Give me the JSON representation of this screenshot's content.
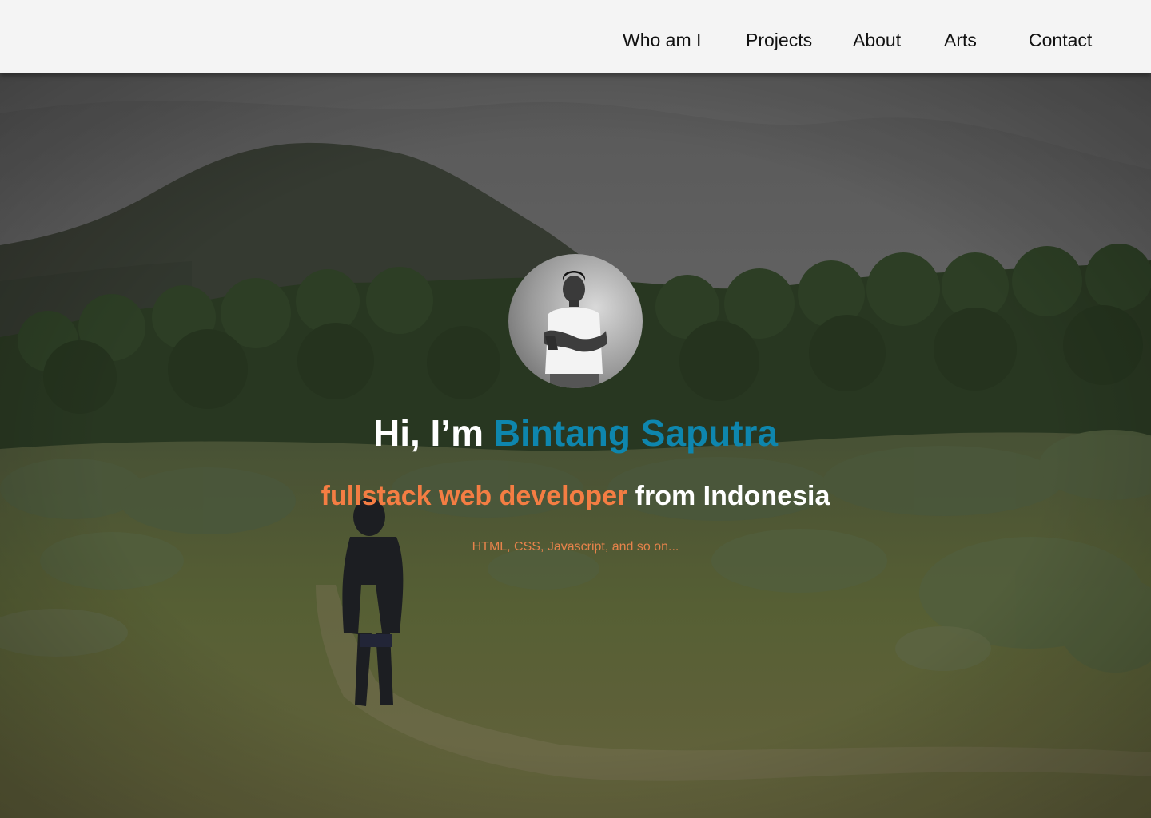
{
  "nav": {
    "items": [
      {
        "label": "Who am I"
      },
      {
        "label": "Projects"
      },
      {
        "label": "About"
      },
      {
        "label": "Arts"
      },
      {
        "label": "Contact"
      }
    ]
  },
  "hero": {
    "greeting_prefix": "Hi, I’m ",
    "name": "Bintang Saputra",
    "role": "fullstack web developer",
    "location_text": " from Indonesia",
    "skills": "HTML, CSS, Javascript, and so on..."
  },
  "colors": {
    "nav_background": "#f4f4f4",
    "name_accent": "#0e86ae",
    "role_accent": "#f47d43",
    "skills_text": "#e7834b"
  }
}
